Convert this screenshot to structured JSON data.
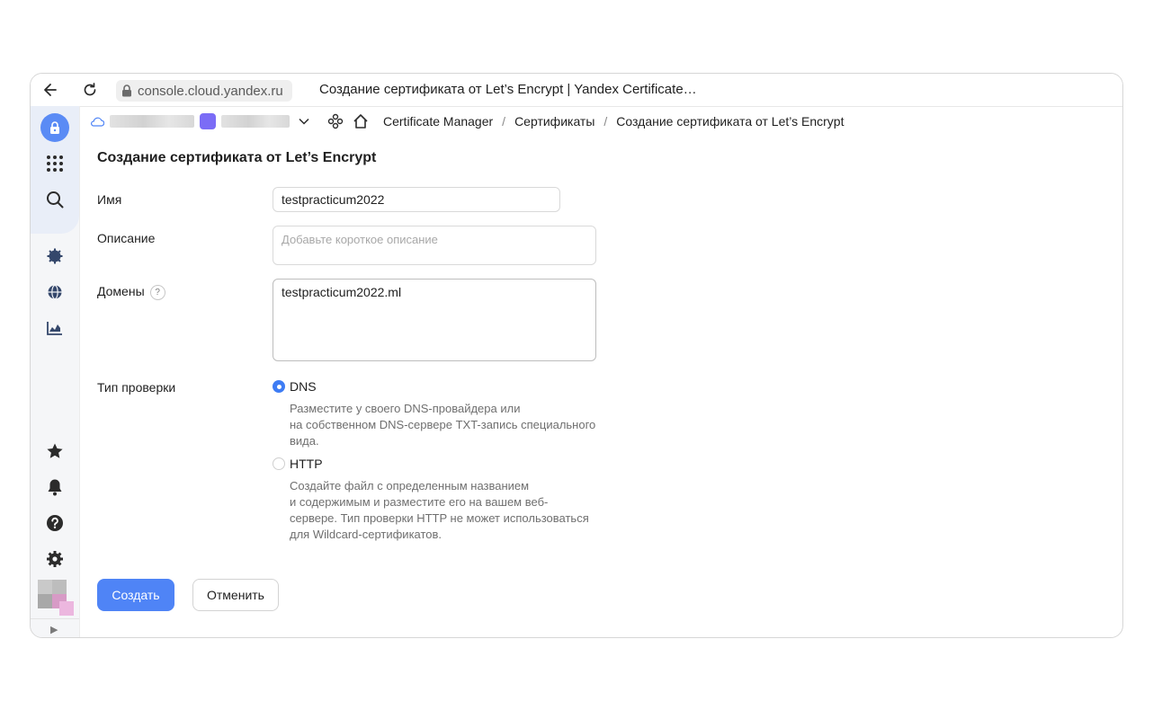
{
  "browser": {
    "url": "console.cloud.yandex.ru",
    "tab_title": "Создание сертификата от Let’s Encrypt | Yandex Certificate…"
  },
  "breadcrumb": {
    "items": [
      "Certificate Manager",
      "Сертификаты",
      "Создание сертификата от Let’s Encrypt"
    ],
    "separator": "/"
  },
  "form": {
    "title": "Создание сертификата от Let’s Encrypt",
    "name_label": "Имя",
    "name_value": "testpracticum2022",
    "description_label": "Описание",
    "description_placeholder": "Добавьте короткое описание",
    "domains_label": "Домены",
    "domains_help": "?",
    "domains_value": "testpracticum2022.ml",
    "check_type_label": "Тип проверки",
    "options": [
      {
        "label": "DNS",
        "selected": true,
        "description_lines": [
          "Разместите у своего DNS-провайдера или",
          "на собственном DNS-сервере TXT-запись специального",
          "вида."
        ]
      },
      {
        "label": "HTTP",
        "selected": false,
        "description_lines": [
          "Создайте файл с определенным названием",
          "и содержимым и разместите его на вашем веб-",
          "сервере. Тип проверки HTTP не может использоваться",
          "для Wildcard-сертификатов."
        ]
      }
    ],
    "create_label": "Создать",
    "cancel_label": "Отменить"
  },
  "colors": {
    "accent": "#4f84f6",
    "sidebar_active": "#5a8bf5",
    "folder": "#7b6cf6"
  },
  "sidebar_icons": [
    "lock-icon",
    "apps-grid-icon",
    "search-icon",
    "gear-chip-icon",
    "globe-icon",
    "chart-icon",
    "star-icon",
    "bell-icon",
    "help-icon",
    "settings-icon"
  ]
}
